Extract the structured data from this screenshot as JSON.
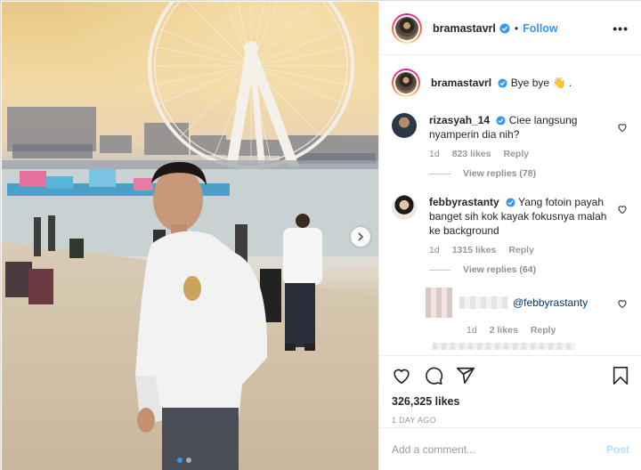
{
  "post": {
    "username": "bramastavrl",
    "follow_separator": "•",
    "follow_label": "Follow",
    "more_label": "•••"
  },
  "caption": {
    "username": "bramastavrl",
    "text": "Bye bye",
    "trailing": " ."
  },
  "comments": [
    {
      "username": "rizasyah_14",
      "text": "Ciee langsung nyamperin dia nih?",
      "time": "1d",
      "likes": "823 likes",
      "reply_label": "Reply",
      "view_replies": "View replies (78)"
    },
    {
      "username": "febbyrastanty",
      "text": "Yang fotoin payah banget sih kok kayak fokusnya malah ke background",
      "time": "1d",
      "likes": "1315 likes",
      "reply_label": "Reply",
      "view_replies": "View replies (64)"
    }
  ],
  "nested_reply": {
    "mention": "@febbyrastanty",
    "time": "1d",
    "likes": "2 likes",
    "reply_label": "Reply"
  },
  "actions": {
    "likes_count": "326,325 likes",
    "time_ago": "1 DAY AGO"
  },
  "composer": {
    "placeholder": "Add a comment...",
    "post_label": "Post"
  },
  "carousel": {
    "slide_count": 2,
    "active_index": 0
  },
  "colors": {
    "accent": "#3897f0",
    "verified": "#3897f0",
    "muted": "#8e8e8e"
  },
  "icons": [
    "verified-badge-icon",
    "more-options-icon",
    "heart-icon",
    "comment-icon",
    "share-icon",
    "bookmark-icon",
    "chevron-right-icon",
    "waving-hand-emoji"
  ]
}
